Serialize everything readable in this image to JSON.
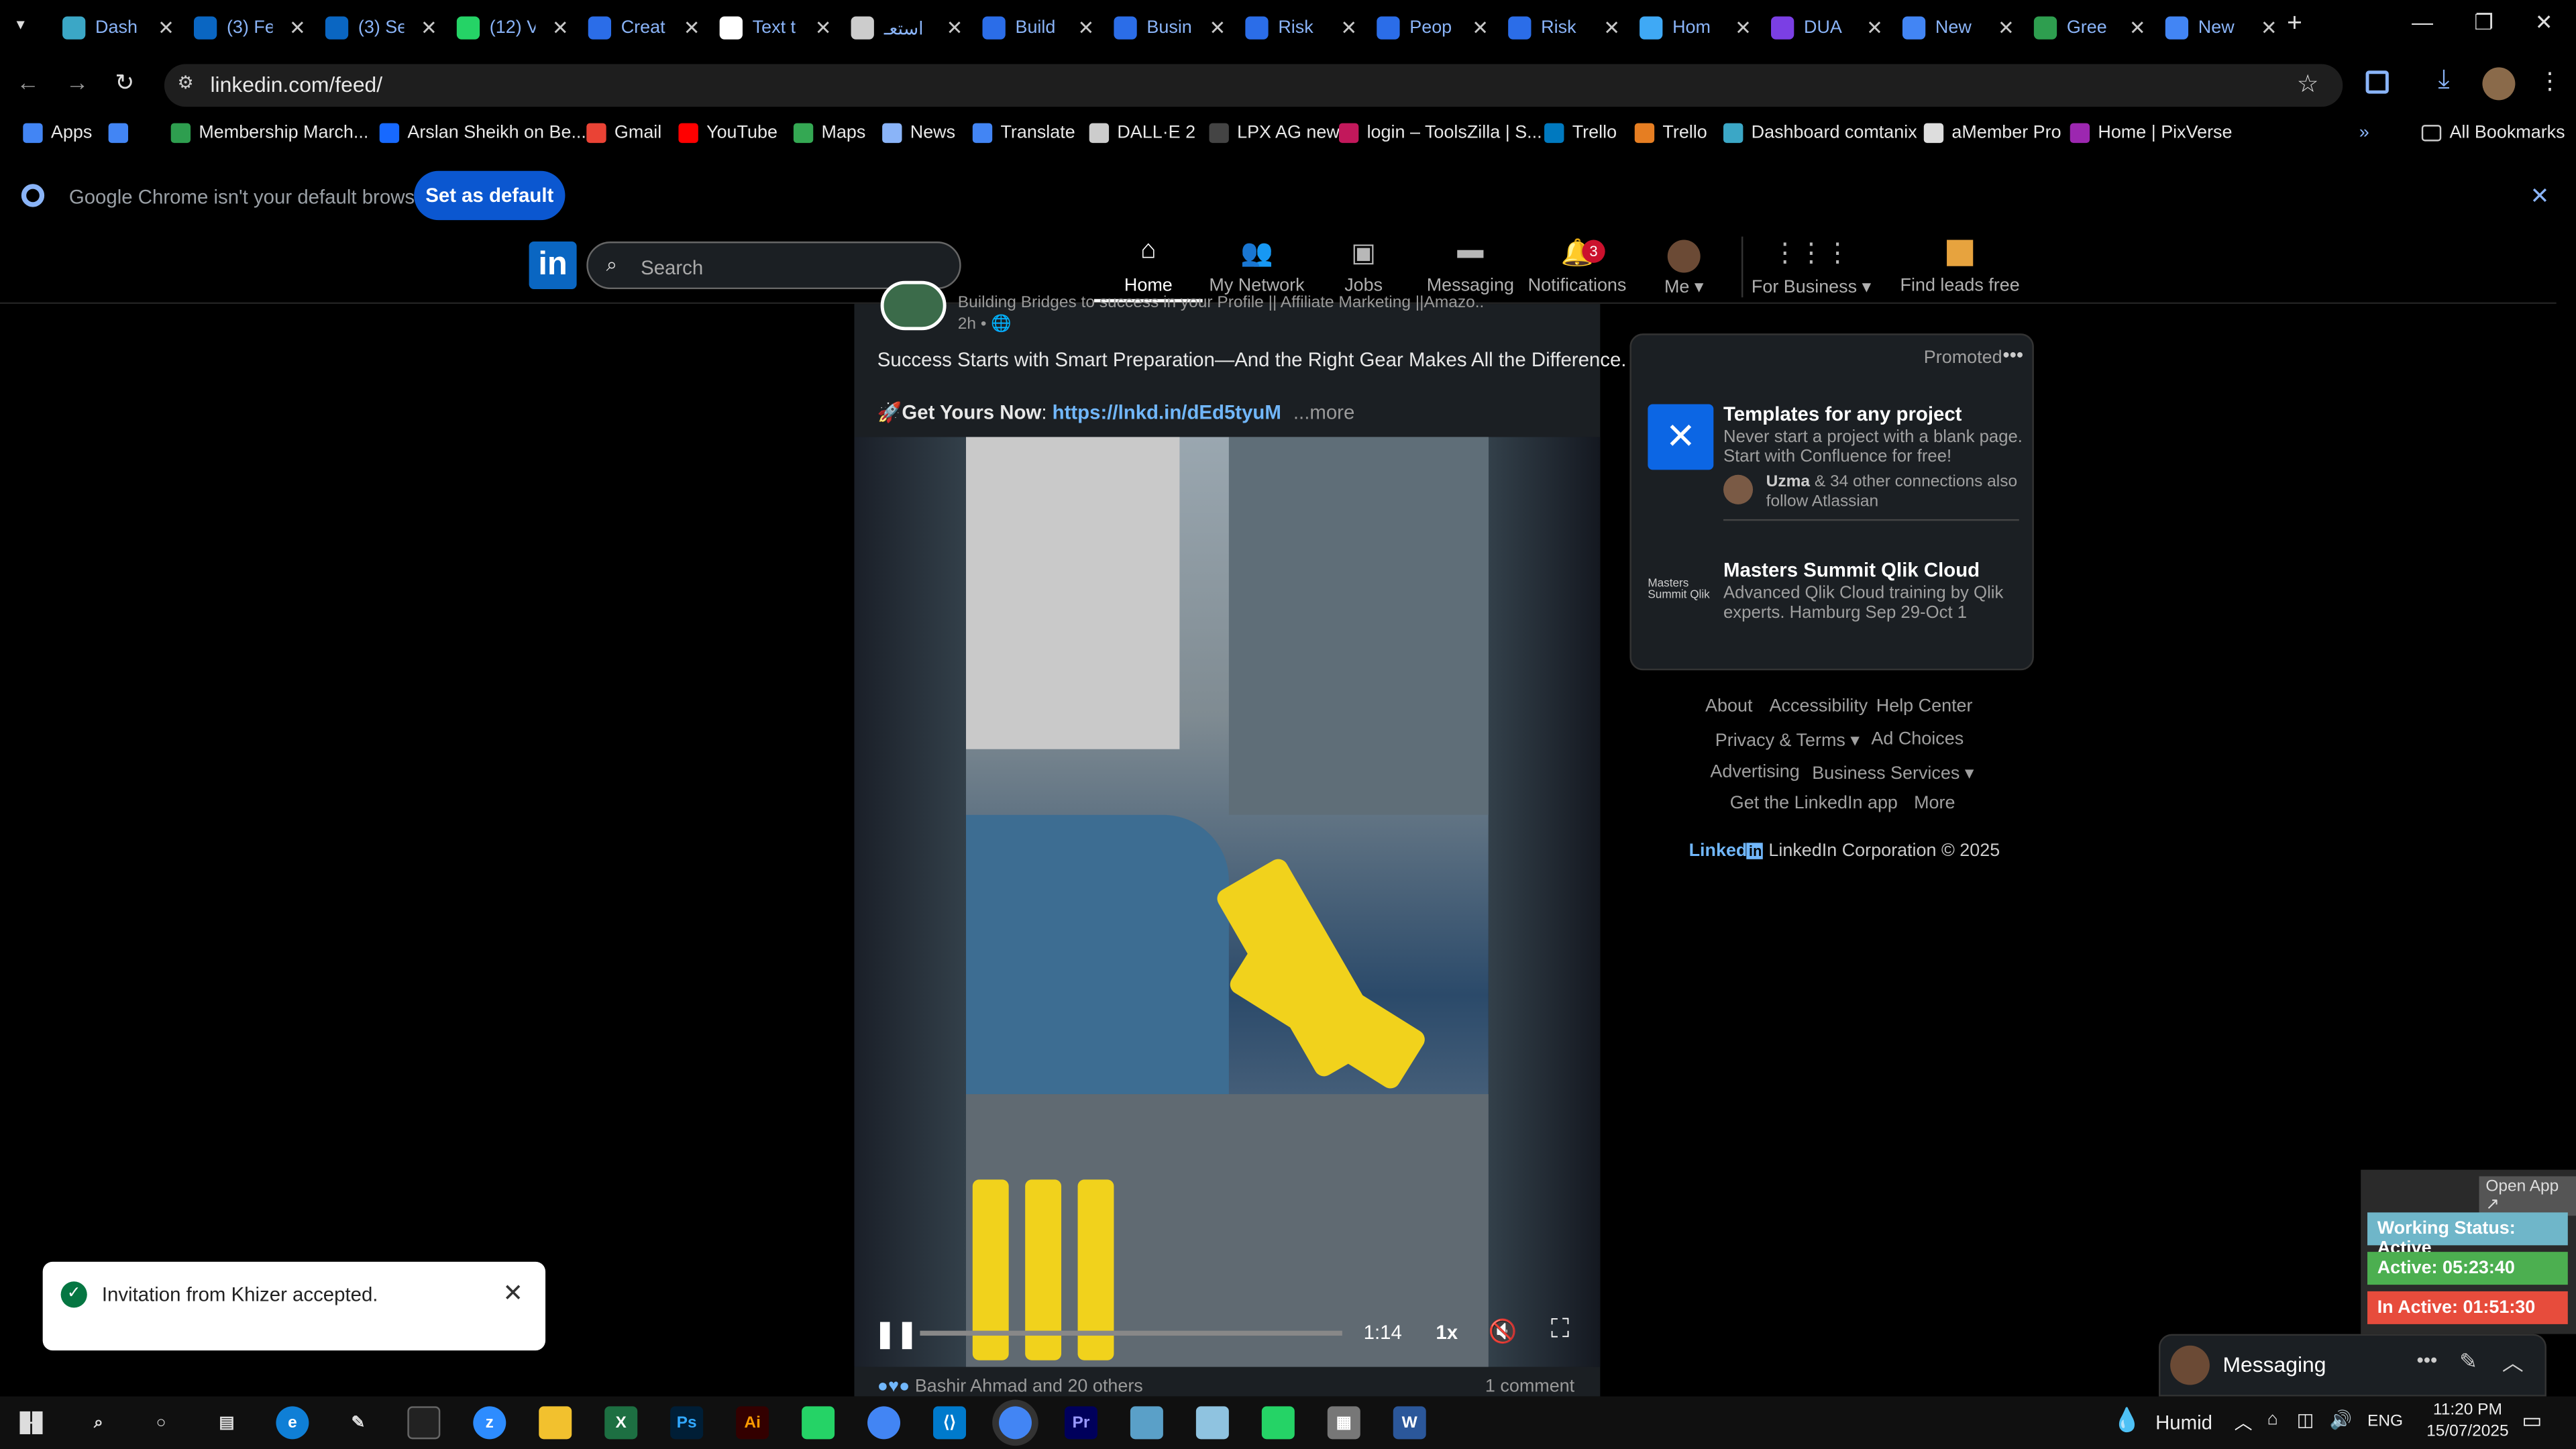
{
  "tabs": [
    {
      "title": "Dash",
      "icon": "dashboard-icon",
      "color": "#3ba7c6"
    },
    {
      "title": "(3) Fe",
      "icon": "linkedin-icon",
      "color": "#0a66c2"
    },
    {
      "title": "(3) Se",
      "icon": "linkedin-icon",
      "color": "#0a66c2"
    },
    {
      "title": "(12) V",
      "icon": "whatsapp-icon",
      "color": "#25d366"
    },
    {
      "title": "Creat",
      "icon": "docs-icon",
      "color": "#2b6de8"
    },
    {
      "title": "Text t",
      "icon": "text-icon",
      "color": "#ffffff"
    },
    {
      "title": "استعـ",
      "icon": "openai-icon",
      "color": "#cccccc"
    },
    {
      "title": "Build",
      "icon": "docs-icon",
      "color": "#2b6de8"
    },
    {
      "title": "Busin",
      "icon": "docs-icon",
      "color": "#2b6de8"
    },
    {
      "title": "Risk",
      "icon": "docs-icon",
      "color": "#2b6de8"
    },
    {
      "title": "Peop",
      "icon": "docs-icon",
      "color": "#2b6de8"
    },
    {
      "title": "Risk",
      "icon": "docs-icon",
      "color": "#2b6de8"
    },
    {
      "title": "Hom",
      "icon": "home-icon",
      "color": "#3fa9f5"
    },
    {
      "title": "DUA",
      "icon": "video-icon",
      "color": "#7b3fe4"
    },
    {
      "title": "New",
      "icon": "chrome-icon",
      "color": "#4285f4"
    },
    {
      "title": "Gree",
      "icon": "palm-icon",
      "color": "#2e9e4f"
    },
    {
      "title": "New",
      "icon": "chrome-icon",
      "color": "#4285f4"
    }
  ],
  "address": {
    "url": "linkedin.com/feed/"
  },
  "bookmarks": [
    {
      "label": "Apps",
      "color": "#4285f4"
    },
    {
      "label": "",
      "color": "#4285f4"
    },
    {
      "label": "Membership March...",
      "color": "#2e9e4f"
    },
    {
      "label": "Arslan Sheikh on Be...",
      "color": "#1769ff"
    },
    {
      "label": "Gmail",
      "color": "#ea4335"
    },
    {
      "label": "YouTube",
      "color": "#ff0000"
    },
    {
      "label": "Maps",
      "color": "#34a853"
    },
    {
      "label": "News",
      "color": "#8ab4f8"
    },
    {
      "label": "Translate",
      "color": "#4285f4"
    },
    {
      "label": "DALL·E 2",
      "color": "#cccccc"
    },
    {
      "label": "LPX AG new",
      "color": "#444444"
    },
    {
      "label": "login – ToolsZilla | S...",
      "color": "#c2185b"
    },
    {
      "label": "Trello",
      "color": "#0079bf"
    },
    {
      "label": "Trello",
      "color": "#e67e22"
    },
    {
      "label": "Dashboard comtanix",
      "color": "#3ba7c6"
    },
    {
      "label": "aMember Pro",
      "color": "#dddddd"
    },
    {
      "label": "Home | PixVerse",
      "color": "#9c27b0"
    }
  ],
  "bookmarks_all": "All Bookmarks",
  "infobar": {
    "message": "Google Chrome isn't your default browser",
    "button": "Set as default"
  },
  "linkedin_nav": {
    "search_placeholder": "Search",
    "items": [
      {
        "label": "Home",
        "icon": "home-icon"
      },
      {
        "label": "My Network",
        "icon": "network-icon"
      },
      {
        "label": "Jobs",
        "icon": "briefcase-icon"
      },
      {
        "label": "Messaging",
        "icon": "chat-icon"
      },
      {
        "label": "Notifications",
        "icon": "bell-icon",
        "badge": "3"
      },
      {
        "label": "Me",
        "icon": "avatar-icon"
      },
      {
        "label": "For Business",
        "icon": "grid-icon"
      },
      {
        "label": "Find leads free",
        "icon": "leads-icon"
      }
    ]
  },
  "post": {
    "headline": "Building Bridges to success in your Profile || Affiliate Marketing ||Amazo...",
    "time": "2h",
    "text": "Success Starts with Smart Preparation—And the Right Gear Makes All the Difference.",
    "cta_label": "Get Yours Now",
    "link": "https://lnkd.in/dEd5tyuM",
    "more": "...more",
    "reactions": "Bashir Ahmad and 20 others",
    "comments": "1 comment",
    "video": {
      "time": "1:14",
      "speed": "1x",
      "progress": 0.0
    }
  },
  "promoted": {
    "label": "Promoted",
    "ads": [
      {
        "title": "Templates for any project",
        "desc": "Never start a project with a blank page. Start with Confluence for free!",
        "social_bold": "Uzma",
        "social": "& 34 other connections also follow Atlassian"
      },
      {
        "title": "Masters Summit Qlik Cloud",
        "desc": "Advanced Qlik Cloud training by Qlik experts. Hamburg Sep 29-Oct 1"
      }
    ]
  },
  "footer": {
    "links": [
      "About",
      "Accessibility",
      "Help Center",
      "Privacy & Terms",
      "Ad Choices",
      "Advertising",
      "Business Services",
      "Get the LinkedIn app",
      "More"
    ],
    "brand": "Linked",
    "copyright": "LinkedIn Corporation © 2025"
  },
  "toast": {
    "text": "Invitation from Khizer accepted."
  },
  "messaging": {
    "label": "Messaging"
  },
  "status_widget": {
    "open": "Open App ↗",
    "working": "Working Status: Active",
    "active": "Active: 05:23:40",
    "inactive": "In Active: 01:51:30"
  },
  "taskbar": {
    "weather": "Humid",
    "lang": "ENG",
    "time": "11:20 PM",
    "date": "15/07/2025"
  }
}
